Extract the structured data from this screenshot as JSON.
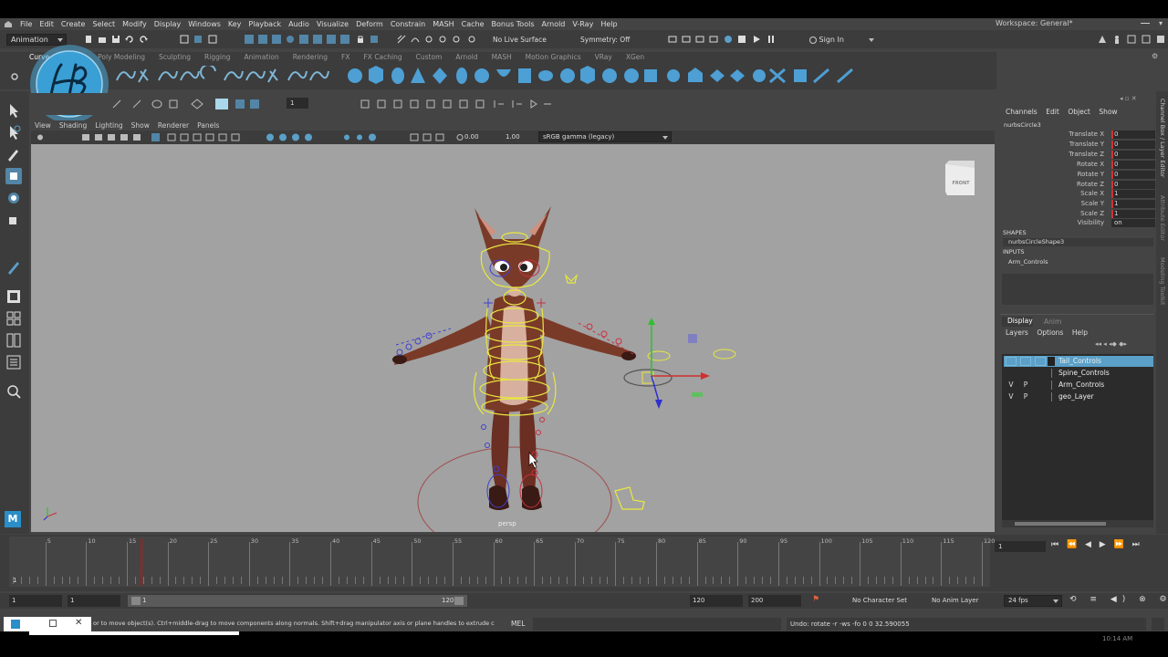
{
  "menubar": {
    "items": [
      "File",
      "Edit",
      "Create",
      "Select",
      "Modify",
      "Display",
      "Windows",
      "Key",
      "Playback",
      "Audio",
      "Visualize",
      "Deform",
      "Constrain",
      "MASH",
      "Cache",
      "Bonus Tools",
      "Arnold",
      "V-Ray",
      "Help"
    ],
    "workspace_label": "Workspace:",
    "workspace_value": "General*"
  },
  "statusline": {
    "menuset": "Animation",
    "live_surface": "No Live Surface",
    "symmetry": "Symmetry: Off",
    "sign_in": "Sign In"
  },
  "shelf": {
    "tabs": [
      "Curves / Surfaces",
      "Poly Modeling",
      "Sculpting",
      "Rigging",
      "Animation",
      "Rendering",
      "FX",
      "FX Caching",
      "Custom",
      "Arnold",
      "MASH",
      "Motion Graphics",
      "VRay",
      "XGen"
    ],
    "active_tab": "Curves / Surfaces",
    "visible_first_tab_text": "Curve",
    "logo_text": "HB"
  },
  "toolbar2": {
    "frame_value": "1"
  },
  "panel": {
    "menus": [
      "View",
      "Shading",
      "Lighting",
      "Show",
      "Renderer",
      "Panels"
    ],
    "exposure": "0.00",
    "gamma": "1.00",
    "colorspace": "sRGB gamma (legacy)",
    "camera_label": "persp",
    "viewcube_label": "FRONT"
  },
  "channel_box": {
    "menus": [
      "Channels",
      "Edit",
      "Object",
      "Show"
    ],
    "object_name": "nurbsCircle3",
    "attributes": [
      {
        "name": "Translate X",
        "value": "0"
      },
      {
        "name": "Translate Y",
        "value": "0"
      },
      {
        "name": "Translate Z",
        "value": "0"
      },
      {
        "name": "Rotate X",
        "value": "0"
      },
      {
        "name": "Rotate Y",
        "value": "0"
      },
      {
        "name": "Rotate Z",
        "value": "0"
      },
      {
        "name": "Scale X",
        "value": "1"
      },
      {
        "name": "Scale Y",
        "value": "1"
      },
      {
        "name": "Scale Z",
        "value": "1"
      },
      {
        "name": "Visibility",
        "value": "on"
      }
    ],
    "shapes_header": "SHAPES",
    "shape_name": "nurbsCircleShape3",
    "inputs_header": "INPUTS",
    "input_name": "Arm_Controls",
    "side_tabs": [
      "Channel Box / Layer Editor",
      "Attribute Editor",
      "Modeling Toolkit"
    ]
  },
  "layer_editor": {
    "tabs": [
      "Display",
      "Anim"
    ],
    "active_tab": "Display",
    "menus": [
      "Layers",
      "Options",
      "Help"
    ],
    "layers": [
      {
        "v": "",
        "p": "",
        "name": "Tail_Controls",
        "selected": true
      },
      {
        "v": "",
        "p": "",
        "name": "Spine_Controls",
        "selected": false
      },
      {
        "v": "V",
        "p": "P",
        "name": "Arm_Controls",
        "selected": false
      },
      {
        "v": "V",
        "p": "P",
        "name": "geo_Layer",
        "selected": false
      }
    ]
  },
  "timeline": {
    "ticks": [
      "5",
      "10",
      "15",
      "20",
      "25",
      "30",
      "35",
      "40",
      "45",
      "50",
      "55",
      "60",
      "65",
      "70",
      "75",
      "80",
      "85",
      "90",
      "95",
      "100",
      "105",
      "110",
      "115",
      "120"
    ],
    "current_frame_marker": "1",
    "current_frame_field": "1"
  },
  "range": {
    "start": "1",
    "start_inner": "1",
    "range_start_label": "1",
    "range_end_label": "120",
    "end_inner": "120",
    "end": "200",
    "character_set": "No Character Set",
    "anim_layer": "No Anim Layer",
    "fps": "24 fps"
  },
  "command": {
    "help_text": "or to move object(s). Ctrl+middle-drag to move components along normals. Shift+drag manipulator axis or plane handles to extrude components or c",
    "mel_label": "MEL",
    "result": "Undo: rotate -r -ws -fo 0 0 32.590055"
  },
  "taskbar": {
    "clock": "10:14 AM"
  },
  "colors": {
    "accent": "#5285a6",
    "selected_layer": "#5aa0c8",
    "control_yellow": "#e8e840",
    "fox_body": "#7a3a28"
  }
}
